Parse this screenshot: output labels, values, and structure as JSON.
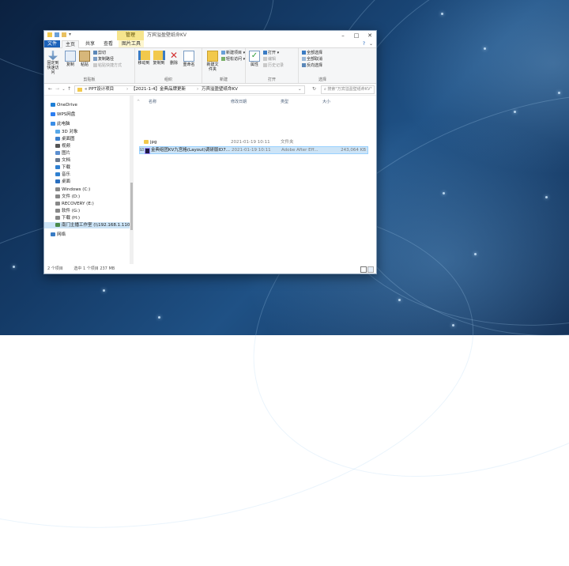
{
  "window": {
    "title": "万宾溢盈壁纸命KV",
    "context_tab": "管理"
  },
  "tabs": [
    "文件",
    "主页",
    "共享",
    "查看",
    "图片工具"
  ],
  "ribbon": {
    "clipboard": {
      "label": "剪贴板",
      "pin": "固定到快速访问",
      "copy": "复制",
      "paste": "粘贴",
      "cut": "剪切",
      "copy_path": "复制路径",
      "paste_shortcut": "粘贴快捷方式"
    },
    "organize": {
      "label": "组织",
      "move_to": "移动到",
      "copy_to": "复制到",
      "delete": "删除",
      "rename": "重命名"
    },
    "new": {
      "label": "新建",
      "new_folder": "新建文件夹",
      "new_item": "新建项目",
      "easy_access": "轻松访问"
    },
    "open": {
      "label": "打开",
      "properties": "属性",
      "open": "打开",
      "edit": "编辑",
      "history": "历史记录"
    },
    "select": {
      "label": "选择",
      "select_all": "全部选择",
      "select_none": "全部取消",
      "invert": "反向选择"
    }
  },
  "address": {
    "crumbs": [
      "« PPT设计项目",
      "【2021-1-4】金典品牌更新",
      "万宾溢盈壁纸命KV"
    ],
    "search_placeholder": "搜索\"万宾溢盈壁纸命KV\""
  },
  "nav": [
    {
      "label": "OneDrive",
      "icon": "cloud-icon",
      "color": "#1e7fd6"
    },
    {
      "label": "WPS网盘",
      "icon": "cloud-icon",
      "color": "#2d7ef0"
    },
    {
      "label": "此电脑",
      "icon": "computer-icon",
      "color": "#3a8ee6"
    },
    {
      "label": "3D 对象",
      "icon": "cube-icon",
      "color": "#58a8e8"
    },
    {
      "label": "桌面图",
      "icon": "desktop-icon",
      "color": "#3b7ecb"
    },
    {
      "label": "视频",
      "icon": "video-icon",
      "color": "#555"
    },
    {
      "label": "图片",
      "icon": "picture-icon",
      "color": "#5c8fd0"
    },
    {
      "label": "文档",
      "icon": "document-icon",
      "color": "#6a7a90"
    },
    {
      "label": "下载",
      "icon": "download-icon",
      "color": "#2f80d1"
    },
    {
      "label": "音乐",
      "icon": "music-icon",
      "color": "#2f80d1"
    },
    {
      "label": "桌面",
      "icon": "desktop-icon",
      "color": "#2a6fbf"
    },
    {
      "label": "Windows (C:)",
      "icon": "drive-icon",
      "color": "#888"
    },
    {
      "label": "文件 (D:)",
      "icon": "drive-icon",
      "color": "#888"
    },
    {
      "label": "RECOVERY (E:)",
      "icon": "drive-icon",
      "color": "#888"
    },
    {
      "label": "软件 (G:)",
      "icon": "drive-icon",
      "color": "#888"
    },
    {
      "label": "下载 (H:)",
      "icon": "drive-icon",
      "color": "#888"
    },
    {
      "label": "南门主播工作室 (\\\\192.168.1.110) (Z:)",
      "icon": "network-drive-icon",
      "color": "#4a8a4a",
      "selected": true
    },
    {
      "label": "网络",
      "icon": "network-icon",
      "color": "#3a7cc4"
    }
  ],
  "columns": [
    "名称",
    "修改日期",
    "类型",
    "大小"
  ],
  "files": [
    {
      "name": "jpg",
      "modified": "2021-01-19 10:11",
      "type": "文件夹",
      "size": "",
      "icon": "folder-icon",
      "selected": false
    },
    {
      "name": "金典组团KV九宫格(Layout)调研版ID7...",
      "modified": "2021-01-19 10:11",
      "type": "Adobe After Eff...",
      "size": "243,064 KB",
      "icon": "after-effects-icon",
      "selected": true
    }
  ],
  "status": {
    "count": "2 个项目",
    "selection": "选中 1 个项目 237 MB"
  }
}
